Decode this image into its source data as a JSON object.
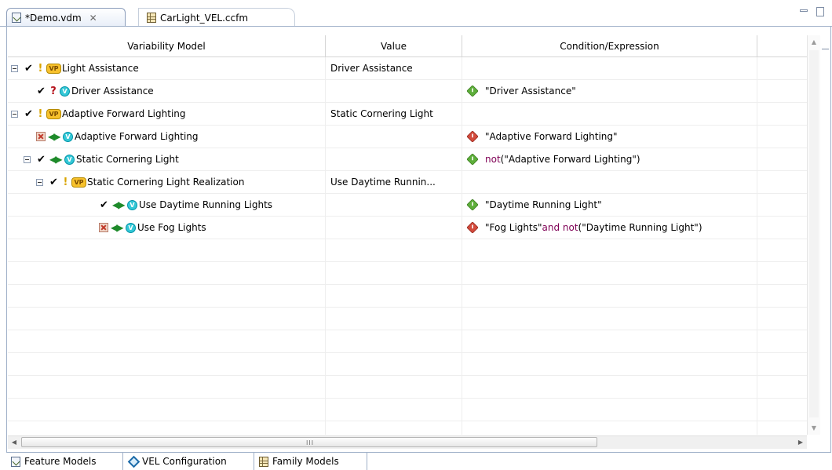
{
  "editor_tabs": [
    {
      "label": "*Demo.vdm",
      "icon": "vdm-file-icon",
      "active": true,
      "closable": true
    },
    {
      "label": "CarLight_VEL.ccfm",
      "icon": "ccfm-file-icon",
      "active": false,
      "closable": false
    }
  ],
  "table": {
    "columns": [
      "Variability Model",
      "Value",
      "Condition/Expression",
      ""
    ],
    "rows": [
      {
        "name": "Light Assistance",
        "value": "Driver Assistance",
        "condition": "",
        "kind": "variation-point",
        "status": "selected",
        "marker": "warning",
        "expanded": true
      },
      {
        "name": "Driver Assistance",
        "value": "",
        "condition": "\"Driver Assistance\"",
        "condition_state": "ok",
        "kind": "variant",
        "status": "selected",
        "marker": "unknown"
      },
      {
        "name": "Adaptive Forward Lighting",
        "value": "Static Cornering Light",
        "condition": "",
        "kind": "variation-point",
        "status": "selected",
        "marker": "warning",
        "expanded": true
      },
      {
        "name": "Adaptive Forward Lighting",
        "value": "",
        "condition": "\"Adaptive Forward Lighting\"",
        "condition_state": "fail",
        "kind": "variant",
        "status": "excluded",
        "marker": "bidirectional"
      },
      {
        "name": "Static Cornering Light",
        "value": "",
        "condition_keyword": "not",
        "condition_rest": "(\"Adaptive Forward Lighting\")",
        "condition_state": "ok",
        "kind": "variant",
        "status": "selected",
        "marker": "bidirectional",
        "expanded": true
      },
      {
        "name": "Static Cornering Light Realization",
        "value": "Use Daytime Runnin...",
        "condition": "",
        "kind": "variation-point",
        "status": "selected",
        "marker": "warning",
        "expanded": true
      },
      {
        "name": "Use Daytime Running Lights",
        "value": "",
        "condition": "\"Daytime Running Light\"",
        "condition_state": "ok",
        "kind": "variant",
        "status": "selected",
        "marker": "bidirectional"
      },
      {
        "name": "Use Fog Lights",
        "value": "",
        "condition_part1": "\"Fog Lights\" ",
        "condition_keyword1": "and not",
        "condition_part2": "(\"Daytime Running Light\")",
        "condition_state": "fail",
        "kind": "variant",
        "status": "excluded",
        "marker": "bidirectional"
      }
    ],
    "empty_row_count": 9
  },
  "badges": {
    "variation_point": "VP",
    "variant": "V"
  },
  "glyphs": {
    "check": "✔",
    "warning": "!",
    "unknown": "?",
    "bidirectional": "◀▶",
    "close": "✕",
    "scroll_up": "▲",
    "scroll_down": "▼",
    "scroll_left": "◀",
    "scroll_right": "▶",
    "grip": "III"
  },
  "bottom_tabs": [
    {
      "label": "Feature Models",
      "icon": "feature-models-icon",
      "active": false
    },
    {
      "label": "VEL Configuration",
      "icon": "vel-configuration-icon",
      "active": true
    },
    {
      "label": "Family Models",
      "icon": "family-models-icon",
      "active": false
    }
  ],
  "colors": {
    "keyword": "#7f0055",
    "condition_ok": "#5dae3a",
    "condition_fail": "#d24a3c",
    "vp_badge": "#f7c12c",
    "variant_badge": "#33c7d6"
  }
}
